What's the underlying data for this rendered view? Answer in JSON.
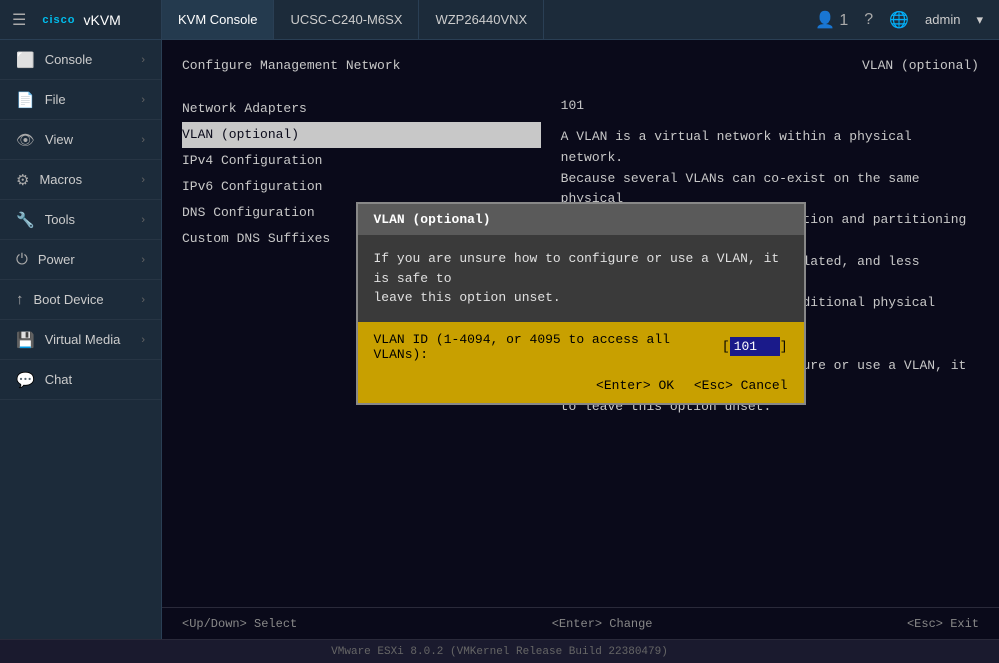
{
  "topbar": {
    "logo": {
      "cisco": "cisco",
      "app": "vKVM"
    },
    "tabs": [
      {
        "label": "KVM Console",
        "active": true
      },
      {
        "label": "UCSC-C240-M6SX",
        "active": false
      },
      {
        "label": "WZP26440VNX",
        "active": false
      }
    ],
    "right": {
      "user_icon": "👤",
      "user_count": "1",
      "help_icon": "?",
      "globe_icon": "🌐",
      "username": "admin",
      "chevron": "▾"
    }
  },
  "sidebar": {
    "items": [
      {
        "label": "Console",
        "icon": "▪",
        "has_arrow": true
      },
      {
        "label": "File",
        "icon": "📄",
        "has_arrow": true
      },
      {
        "label": "View",
        "icon": "👁",
        "has_arrow": true
      },
      {
        "label": "Macros",
        "icon": "⚙",
        "has_arrow": true
      },
      {
        "label": "Tools",
        "icon": "🔧",
        "has_arrow": true
      },
      {
        "label": "Power",
        "icon": "⏻",
        "has_arrow": true
      },
      {
        "label": "Boot Device",
        "icon": "↑",
        "has_arrow": true
      },
      {
        "label": "Virtual Media",
        "icon": "💾",
        "has_arrow": true
      },
      {
        "label": "Chat",
        "icon": "💬",
        "has_arrow": false
      }
    ]
  },
  "terminal": {
    "title_left": "Configure Management Network",
    "title_right": "VLAN (optional)",
    "menu_items": [
      "Network Adapters",
      "VLAN (optional)",
      "IPv4 Configuration",
      "IPv6 Configuration",
      "DNS Configuration",
      "Custom DNS Suffixes"
    ],
    "selected_index": 1,
    "right_value": "101",
    "right_description": [
      "A VLAN is a virtual network within a physical network.",
      "Because several VLANs can co-exist on the same physical",
      "network segment, VLAN configuration and partitioning is",
      "often more flexible, better isolated, and less expensive",
      "than flat networks based on traditional physical topology.",
      "",
      "If you are unsure how to configure or use a VLAN, it is safe",
      "to leave this option unset."
    ]
  },
  "dialog": {
    "title": "VLAN (optional)",
    "description": "If you are unsure how to configure or use a VLAN, it is safe to\nleave this option unset.",
    "input_label": "VLAN ID (1-4094, or 4095 to access all VLANs):",
    "input_value": "101",
    "actions": {
      "ok": "<Enter> OK",
      "cancel": "<Esc> Cancel"
    }
  },
  "status_bar": {
    "left": "<Up/Down> Select",
    "center": "<Enter> Change",
    "right": "<Esc> Exit"
  },
  "bottom_bar": {
    "text": "VMware ESXi 8.0.2 (VMKernel Release Build 22380479)"
  }
}
